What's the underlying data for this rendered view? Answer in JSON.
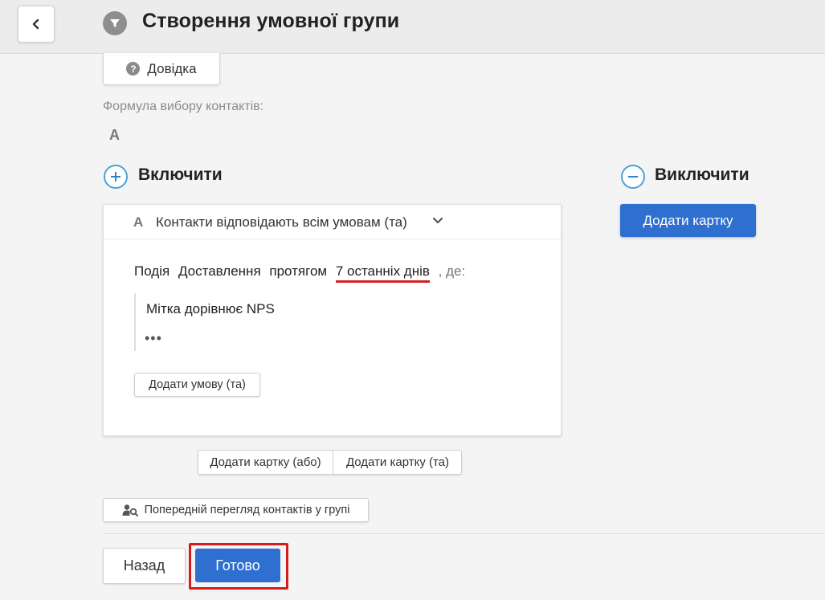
{
  "header": {
    "title": "Створення умовної групи",
    "back_icon": "chevron-left-icon",
    "title_icon": "filter-icon"
  },
  "help": {
    "label": "Довідка",
    "icon": "question-icon"
  },
  "formula": {
    "label": "Формула вибору контактів:",
    "value": "A"
  },
  "include": {
    "title": "Включити",
    "card": {
      "letter": "A",
      "mode": "Контакти відповідають всім умовам (та)",
      "event_word": "Подія",
      "event_name": "Доставлення",
      "period_word": "протягом",
      "period": "7 останніх днів",
      "suffix": ", де:",
      "condition": "Мітка дорівнює NPS",
      "ellipsis": "•••",
      "add_condition": "Додати умову (та)"
    },
    "add_card_or": "Додати картку (або)",
    "add_card_and": "Додати картку (та)"
  },
  "exclude": {
    "title": "Виключити",
    "add_card": "Додати картку"
  },
  "preview": {
    "label": "Попередній перегляд контактів у групі",
    "icon": "user-search-icon"
  },
  "footer": {
    "back": "Назад",
    "done": "Готово"
  },
  "colors": {
    "accent": "#2e6fd0",
    "highlight": "#d51c1c",
    "icon_outline": "#4aa3d8"
  }
}
